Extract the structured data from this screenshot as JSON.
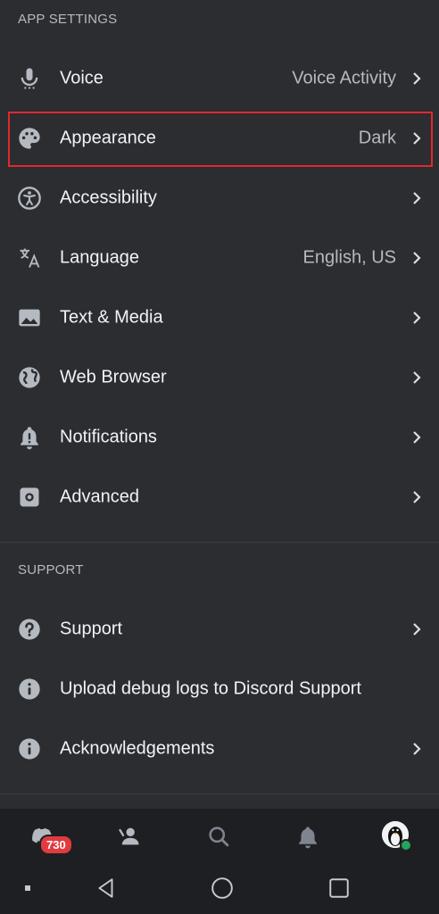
{
  "app_settings": {
    "header": "APP SETTINGS",
    "items": [
      {
        "label": "Voice",
        "value": "Voice Activity",
        "icon": "microphone-icon"
      },
      {
        "label": "Appearance",
        "value": "Dark",
        "icon": "palette-icon"
      },
      {
        "label": "Accessibility",
        "value": "",
        "icon": "accessibility-icon"
      },
      {
        "label": "Language",
        "value": "English, US",
        "icon": "translate-icon"
      },
      {
        "label": "Text & Media",
        "value": "",
        "icon": "image-icon"
      },
      {
        "label": "Web Browser",
        "value": "",
        "icon": "globe-icon"
      },
      {
        "label": "Notifications",
        "value": "",
        "icon": "bell-icon"
      },
      {
        "label": "Advanced",
        "value": "",
        "icon": "chip-icon"
      }
    ]
  },
  "support": {
    "header": "SUPPORT",
    "items": [
      {
        "label": "Support",
        "icon": "question-icon"
      },
      {
        "label": "Upload debug logs to Discord Support",
        "icon": "info-icon"
      },
      {
        "label": "Acknowledgements",
        "icon": "info-icon"
      }
    ]
  },
  "tabbar": {
    "home_badge": "730",
    "tabs": [
      "home-icon",
      "friends-icon",
      "search-icon",
      "bell-icon",
      "avatar"
    ]
  },
  "colors": {
    "background": "#2b2d31",
    "highlight_border": "#e3272f",
    "badge": "#e03b3f",
    "online": "#23a55a"
  }
}
